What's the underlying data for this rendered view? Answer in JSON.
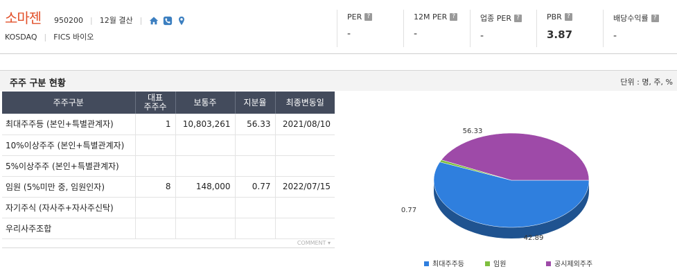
{
  "company": {
    "name": "소마젠",
    "code": "950200",
    "fiscal": "12월 결산",
    "market": "KOSDAQ",
    "sector": "FICS 바이오"
  },
  "icons": [
    "home-icon",
    "phone-icon",
    "map-pin-icon"
  ],
  "metrics": [
    {
      "label": "PER",
      "value": "-"
    },
    {
      "label": "12M PER",
      "value": "-"
    },
    {
      "label": "업종 PER",
      "value": "-"
    },
    {
      "label": "PBR",
      "value": "3.87"
    },
    {
      "label": "배당수익률",
      "value": "-"
    }
  ],
  "section": {
    "title": "주주 구분 현황",
    "unit": "단위 : 명, 주, %"
  },
  "table": {
    "headers": [
      "주주구분",
      "대표\n주주수",
      "보통주",
      "지분율",
      "최종변동일"
    ],
    "rows": [
      {
        "category": "최대주주등 (본인+특별관계자)",
        "count": "1",
        "shares": "10,803,261",
        "ratio": "56.33",
        "date": "2021/08/10"
      },
      {
        "category": "10%이상주주 (본인+특별관계자)",
        "count": "",
        "shares": "",
        "ratio": "",
        "date": ""
      },
      {
        "category": "5%이상주주 (본인+특별관계자)",
        "count": "",
        "shares": "",
        "ratio": "",
        "date": ""
      },
      {
        "category": "임원 (5%미만 중, 임원인자)",
        "count": "8",
        "shares": "148,000",
        "ratio": "0.77",
        "date": "2022/07/15"
      },
      {
        "category": "자기주식 (자사주+자사주신탁)",
        "count": "",
        "shares": "",
        "ratio": "",
        "date": ""
      },
      {
        "category": "우리사주조합",
        "count": "",
        "shares": "",
        "ratio": "",
        "date": ""
      }
    ],
    "comment": "COMMENT"
  },
  "chart_data": {
    "type": "pie",
    "slices": [
      {
        "name": "최대주주등",
        "value": 56.33,
        "color": "#2f7fde"
      },
      {
        "name": "임원",
        "value": 0.77,
        "color": "#7fbf3f"
      },
      {
        "name": "공시제외주주",
        "value": 42.89,
        "color": "#9e4aa8"
      }
    ],
    "labels": [
      "56.33",
      "0.77",
      "42.89"
    ],
    "legend_position": "bottom"
  },
  "colors": {
    "brand": "#e2502a",
    "header_bg": "#434b5c"
  }
}
